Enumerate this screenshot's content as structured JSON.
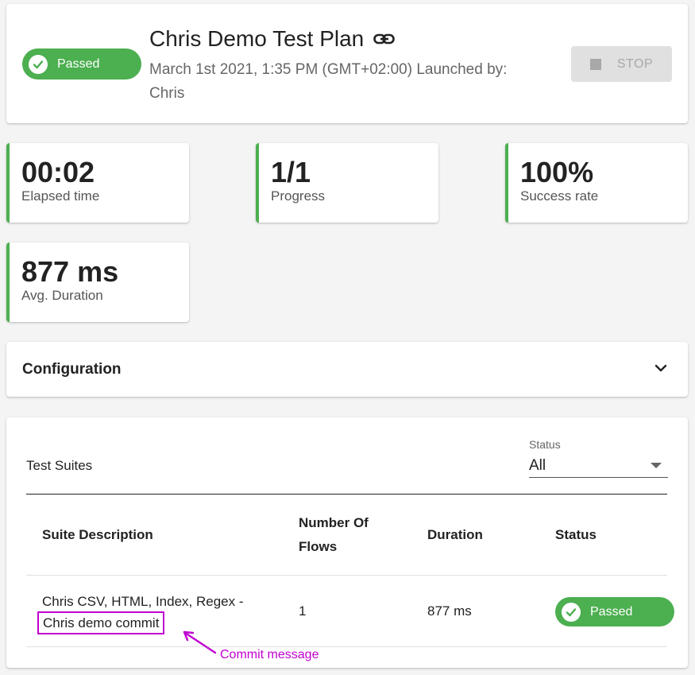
{
  "colors": {
    "success": "#4caf50",
    "annotation": "#c000d0"
  },
  "header": {
    "status": "Passed",
    "title": "Chris Demo Test Plan",
    "meta": "March 1st 2021, 1:35 PM (GMT+02:00) Launched by: Chris",
    "stop_label": "STOP",
    "icons": {
      "status": "check-icon",
      "link": "link-icon",
      "stop": "stop-icon"
    }
  },
  "stats": [
    {
      "value": "00:02",
      "label": "Elapsed time"
    },
    {
      "value": "1/1",
      "label": "Progress"
    },
    {
      "value": "100%",
      "label": "Success rate"
    },
    {
      "value": "877 ms",
      "label": "Avg. Duration"
    }
  ],
  "configuration": {
    "title": "Configuration",
    "icon": "chevron-down-icon"
  },
  "suites": {
    "title": "Test Suites",
    "filter": {
      "label": "Status",
      "value": "All"
    },
    "columns": {
      "description": "Suite Description",
      "flows_line1": "Number Of",
      "flows_line2": "Flows",
      "duration": "Duration",
      "status": "Status"
    },
    "rows": [
      {
        "description_line1": "Chris CSV, HTML, Index, Regex -",
        "description_commit": "Chris demo commit",
        "flows": "1",
        "duration": "877 ms",
        "status": "Passed"
      }
    ]
  },
  "annotation": {
    "text": "Commit message"
  }
}
